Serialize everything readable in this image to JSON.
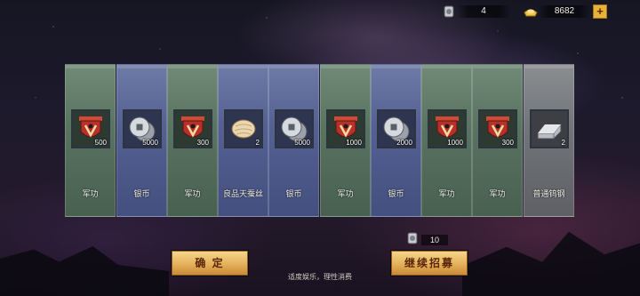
{
  "resources": {
    "token_count": "4",
    "gold_count": "8682",
    "plus_label": "+"
  },
  "rewards": [
    {
      "name": "军功",
      "qty": "500",
      "icon": "military-merit-banner-icon",
      "tint": "green"
    },
    {
      "name": "银币",
      "qty": "5000",
      "icon": "silver-coin-icon",
      "tint": "blue"
    },
    {
      "name": "军功",
      "qty": "300",
      "icon": "military-merit-banner-icon",
      "tint": "green"
    },
    {
      "name": "良品天蚕丝",
      "qty": "2",
      "icon": "silk-cocoon-icon",
      "tint": "blue"
    },
    {
      "name": "银币",
      "qty": "5000",
      "icon": "silver-coin-icon",
      "tint": "blue"
    },
    {
      "name": "军功",
      "qty": "1000",
      "icon": "military-merit-banner-icon",
      "tint": "green"
    },
    {
      "name": "银币",
      "qty": "2000",
      "icon": "silver-coin-icon",
      "tint": "blue"
    },
    {
      "name": "军功",
      "qty": "1000",
      "icon": "military-merit-banner-icon",
      "tint": "green"
    },
    {
      "name": "军功",
      "qty": "300",
      "icon": "military-merit-banner-icon",
      "tint": "green"
    },
    {
      "name": "普通钨钢",
      "qty": "2",
      "icon": "tungsten-steel-ingot-icon",
      "tint": "gray"
    }
  ],
  "buttons": {
    "confirm_label": "确 定",
    "continue_label": "继续招募",
    "continue_cost": "10"
  },
  "notice": "适度娱乐，理性消费",
  "colors": {
    "button_gold": "#e5b05a",
    "button_text": "#5a2608",
    "card_green": "#5a7462",
    "card_blue": "#556193",
    "card_gray": "#72757a"
  }
}
